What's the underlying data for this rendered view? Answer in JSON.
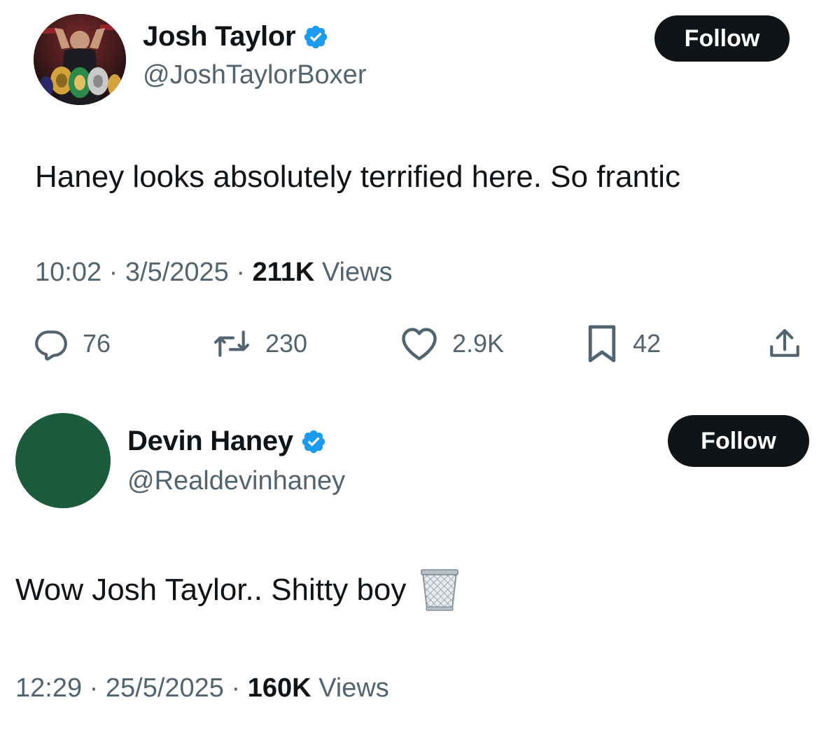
{
  "tweets": [
    {
      "author": {
        "name": "Josh Taylor",
        "handle": "@JoshTaylorBoxer",
        "verified": true,
        "avatar": "boxer-with-championship-belts-photo"
      },
      "follow_label": "Follow",
      "text": "Haney looks absolutely terrified here. So frantic",
      "time": "10:02",
      "date": "3/5/2025",
      "views_count": "211K",
      "views_label": "Views",
      "separator": "·",
      "actions": {
        "replies": "76",
        "reposts": "230",
        "likes": "2.9K",
        "bookmarks": "42"
      }
    },
    {
      "author": {
        "name": "Devin Haney",
        "handle": "@Realdevinhaney",
        "verified": true,
        "avatar": "solid-green-avatar"
      },
      "follow_label": "Follow",
      "text": "Wow Josh Taylor.. Shitty boy",
      "emoji": "wastebasket-emoji",
      "time": "12:29",
      "date": "25/5/2025",
      "views_count": "160K",
      "views_label": "Views",
      "separator": "·"
    }
  ],
  "colors": {
    "text_primary": "#0f1419",
    "text_secondary": "#536471",
    "verified_blue": "#1d9bf0",
    "follow_bg": "#0f1419",
    "avatar_green": "#1b5a3a"
  }
}
